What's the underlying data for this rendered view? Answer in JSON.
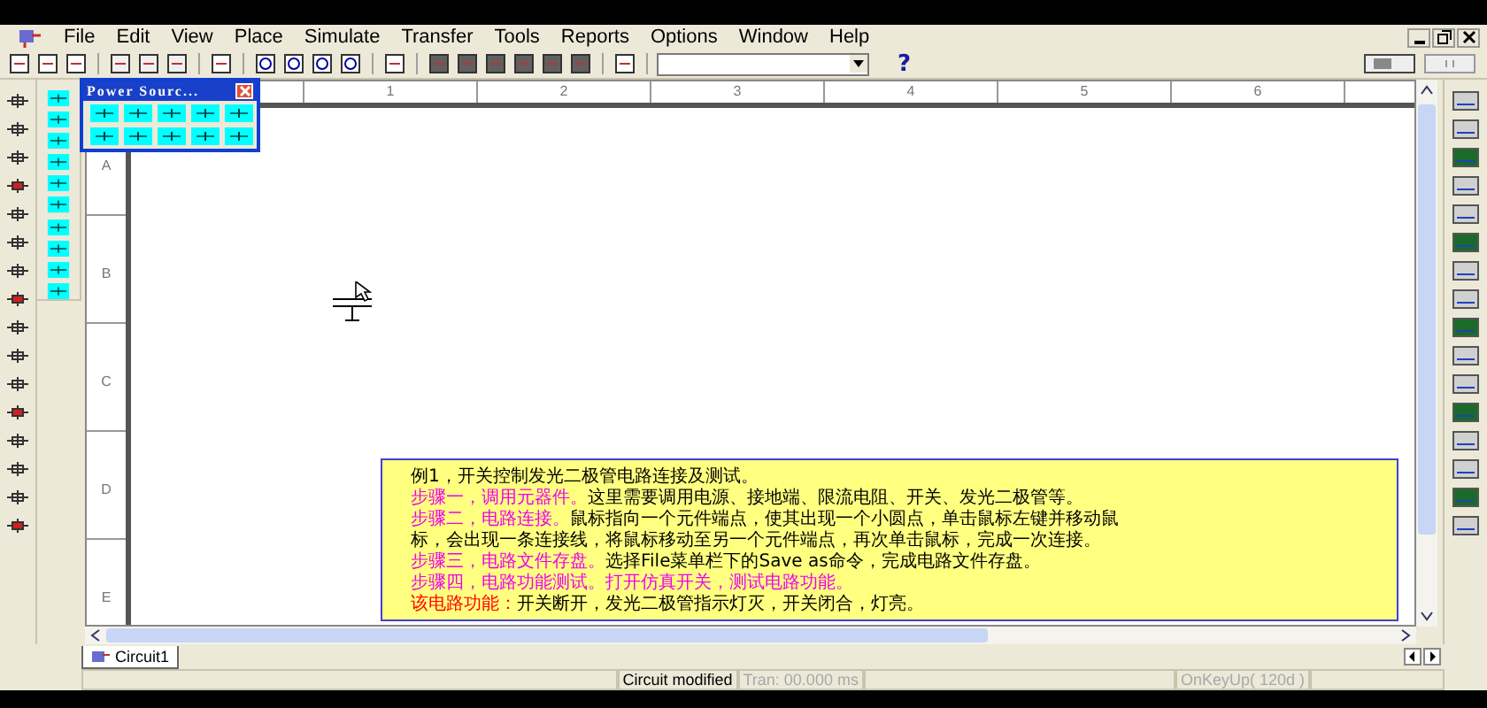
{
  "menu": [
    "File",
    "Edit",
    "View",
    "Place",
    "Simulate",
    "Transfer",
    "Tools",
    "Reports",
    "Options",
    "Window",
    "Help"
  ],
  "toolbar": {
    "help": "?"
  },
  "palette": {
    "title": "Power Sourc..."
  },
  "ruler": {
    "columns": [
      "1",
      "2",
      "3",
      "4",
      "5",
      "6"
    ],
    "rows": [
      "A",
      "B",
      "C",
      "D",
      "E"
    ]
  },
  "note": {
    "lines": [
      [
        {
          "kind": "body",
          "text": "例1，开关控制发光二极管电路连接及测试。"
        }
      ],
      [
        {
          "kind": "step",
          "text": "步骤一，调用元器件。"
        },
        {
          "kind": "body",
          "text": "这里需要调用电源、接地端、限流电阻、开关、发光二极管等。"
        }
      ],
      [
        {
          "kind": "step",
          "text": "步骤二，电路连接。"
        },
        {
          "kind": "body",
          "text": "鼠标指向一个元件端点，使其出现一个小圆点，单击鼠标左键并移动鼠"
        }
      ],
      [
        {
          "kind": "body",
          "text": "标，会出现一条连接线，将鼠标移动至另一个元件端点，再次单击鼠标，完成一次连接。"
        }
      ],
      [
        {
          "kind": "step",
          "text": "步骤三，电路文件存盘。"
        },
        {
          "kind": "body",
          "text": "选择File菜单栏下的Save as命令，完成电路文件存盘。"
        }
      ],
      [
        {
          "kind": "step",
          "text": "步骤四，电路功能测试。打开仿真开关，测试电路功能。"
        }
      ],
      [
        {
          "kind": "label",
          "text": "该电路功能："
        },
        {
          "kind": "body",
          "text": "开关断开，发光二极管指示灯灭，开关闭合，灯亮。"
        }
      ]
    ]
  },
  "tabs": [
    {
      "label": "Circuit1",
      "selected": true
    }
  ],
  "status_bar": [
    {
      "text": "Circuit modified",
      "disabled": false
    },
    {
      "text": "Tran: 00.000 ms",
      "disabled": true
    },
    {
      "text": "OnKeyUp( 120d )",
      "disabled": true
    }
  ]
}
